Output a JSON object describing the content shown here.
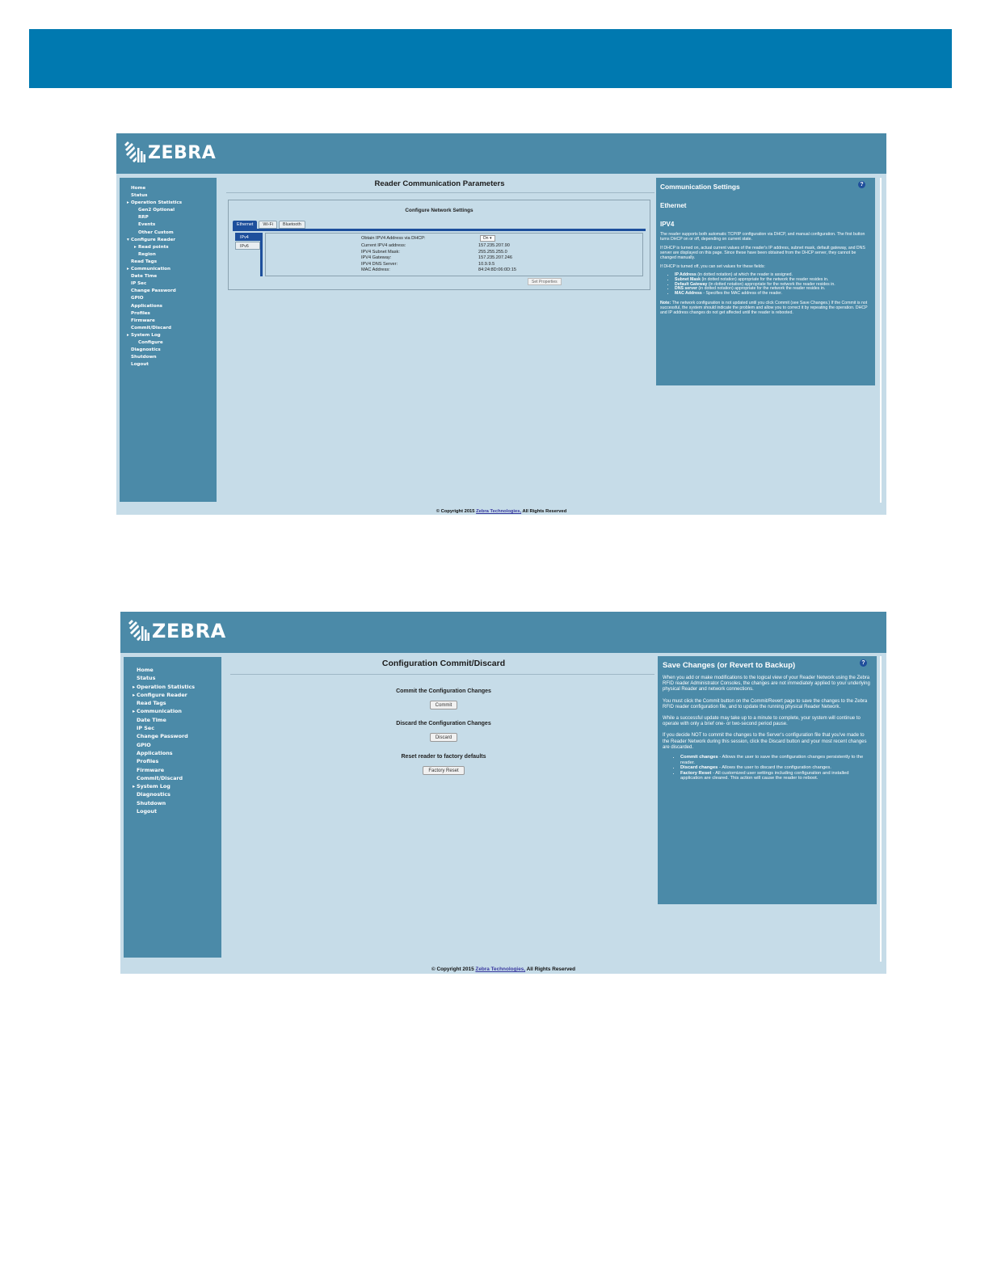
{
  "brand": {
    "logo_text": "ZEBRA"
  },
  "screen1": {
    "nav": [
      {
        "label": "Home",
        "arrow": "",
        "sub": false
      },
      {
        "label": "Status",
        "arrow": "",
        "sub": false
      },
      {
        "label": "Operation Statistics",
        "arrow": "▸",
        "sub": false
      },
      {
        "label": "Gen2 Optional",
        "arrow": "",
        "sub": true
      },
      {
        "label": "RRP",
        "arrow": "",
        "sub": true
      },
      {
        "label": "Events",
        "arrow": "",
        "sub": true
      },
      {
        "label": "Other Custom",
        "arrow": "",
        "sub": true
      },
      {
        "label": "Configure Reader",
        "arrow": "▾",
        "sub": false
      },
      {
        "label": "Read points",
        "arrow": "▸",
        "sub": true
      },
      {
        "label": "Region",
        "arrow": "",
        "sub": true
      },
      {
        "label": "Read Tags",
        "arrow": "",
        "sub": false
      },
      {
        "label": "Communication",
        "arrow": "▸",
        "sub": false
      },
      {
        "label": "Date Time",
        "arrow": "",
        "sub": false
      },
      {
        "label": "IP Sec",
        "arrow": "",
        "sub": false
      },
      {
        "label": "Change Password",
        "arrow": "",
        "sub": false
      },
      {
        "label": "GPIO",
        "arrow": "",
        "sub": false
      },
      {
        "label": "Applications",
        "arrow": "",
        "sub": false
      },
      {
        "label": "Profiles",
        "arrow": "",
        "sub": false
      },
      {
        "label": "Firmware",
        "arrow": "",
        "sub": false
      },
      {
        "label": "Commit/Discard",
        "arrow": "",
        "sub": false
      },
      {
        "label": "System Log",
        "arrow": "▸",
        "sub": false
      },
      {
        "label": "Configure",
        "arrow": "",
        "sub": true
      },
      {
        "label": "Diagnostics",
        "arrow": "",
        "sub": false
      },
      {
        "label": "Shutdown",
        "arrow": "",
        "sub": false
      },
      {
        "label": "Logout",
        "arrow": "",
        "sub": false
      }
    ],
    "title": "Reader Communication Parameters",
    "box_title": "Configure Network Settings",
    "tabs": [
      "Ethernet",
      "Wi-Fi",
      "Bluetooth"
    ],
    "subtabs": [
      "IPv4",
      "IPv6"
    ],
    "rows": [
      {
        "label": "Obtain IPV4 Address via DHCP:",
        "value": "On"
      },
      {
        "label": "Current IPV4 address:",
        "value": "157.235.207.90"
      },
      {
        "label": "IPV4 Subnet Mask:",
        "value": "255.255.255.0"
      },
      {
        "label": "IPV4 Gateway:",
        "value": "157.235.207.246"
      },
      {
        "label": "IPV4 DNS Server:",
        "value": "10.9.9.5"
      },
      {
        "label": "MAC Address:",
        "value": "84:24:8D:06:0D:15"
      }
    ],
    "set_properties": "Set Properties",
    "help": {
      "icon": "?",
      "title": "Communication Settings",
      "h2a": "Ethernet",
      "h2b": "IPV4",
      "p1": "The reader supports both automatic TCP/IP configuration via DHCP, and manual configuration. The first button turns DHCP on or off, depending on current state.",
      "p2": "If DHCP is turned on, actual current values of the reader's IP address, subnet mask, default gateway, and DNS server are displayed on this page. Since these have been obtained from the DHCP server, they cannot be changed manually.",
      "p3": "If DHCP is turned off, you can set values for these fields:",
      "list": [
        {
          "b": "IP Address",
          "t": " (in dotted notation) at which the reader is assigned."
        },
        {
          "b": "Subnet Mask",
          "t": " (in dotted notation) appropriate for the network the reader resides in."
        },
        {
          "b": "Default Gateway",
          "t": " (in dotted notation) appropriate for the network the reader resides in."
        },
        {
          "b": "DNS server",
          "t": " (in dotted notation) appropriate for the network the reader resides in."
        },
        {
          "b": "MAC Address",
          "t": " - Specifies the MAC address of the reader."
        }
      ],
      "note_b": "Note:",
      "note": " The network configuration is not updated until you click Commit (see Save Changes.) If the Commit is not successful, the system should indicate the problem and allow you to correct it by repeating the operation. DHCP and IP address changes do not get affected until the reader is rebooted."
    },
    "footer_pre": "© Copyright 2015 ",
    "footer_link": "Zebra Technologies,",
    "footer_post": " All Rights Reserved"
  },
  "screen2": {
    "nav": [
      {
        "label": "Home",
        "arrow": "",
        "sub": false
      },
      {
        "label": "Status",
        "arrow": "",
        "sub": false
      },
      {
        "label": "Operation Statistics",
        "arrow": "▸",
        "sub": false
      },
      {
        "label": "Configure Reader",
        "arrow": "▸",
        "sub": false
      },
      {
        "label": "Read Tags",
        "arrow": "",
        "sub": false
      },
      {
        "label": "Communication",
        "arrow": "▸",
        "sub": false
      },
      {
        "label": "Date Time",
        "arrow": "",
        "sub": false
      },
      {
        "label": "IP Sec",
        "arrow": "",
        "sub": false
      },
      {
        "label": "Change Password",
        "arrow": "",
        "sub": false
      },
      {
        "label": "GPIO",
        "arrow": "",
        "sub": false
      },
      {
        "label": "Applications",
        "arrow": "",
        "sub": false
      },
      {
        "label": "Profiles",
        "arrow": "",
        "sub": false
      },
      {
        "label": "Firmware",
        "arrow": "",
        "sub": false
      },
      {
        "label": "Commit/Discard",
        "arrow": "",
        "sub": false
      },
      {
        "label": "System Log",
        "arrow": "▸",
        "sub": false
      },
      {
        "label": "Diagnostics",
        "arrow": "",
        "sub": false
      },
      {
        "label": "Shutdown",
        "arrow": "",
        "sub": false
      },
      {
        "label": "Logout",
        "arrow": "",
        "sub": false
      }
    ],
    "title": "Configuration Commit/Discard",
    "commit_label": "Commit the Configuration Changes",
    "commit_button": "Commit",
    "discard_label": "Discard the Configuration Changes",
    "discard_button": "Discard",
    "reset_label": "Reset reader to factory defaults",
    "reset_button": "Factory Reset",
    "help": {
      "icon": "?",
      "title": "Save Changes (or Revert to Backup)",
      "p1": "When you add or make modifications to the logical view of your Reader Network using the Zebra RFID reader Administrator Consoles, the changes are not immediately applied to your underlying physical Reader and network connections.",
      "p2": "You must click the Commit button on the Commit/Revert page to save the changes to the Zebra RFID reader configuration file, and to update the running physical Reader Network.",
      "p3": "While a successful update may take up to a minute to complete, your system will continue to operate with only a brief one- or two-second period pause.",
      "p4": "If you decide NOT to commit the changes to the Server's configuration file that you've made to the Reader Network during this session, click the Discard button and your most recent changes are discarded.",
      "list": [
        {
          "b": "Commit changes",
          "t": " - Allows the user to save the configuration changes persistently to the reader."
        },
        {
          "b": "Discard changes",
          "t": " - Allows the user to discard the configuration changes."
        },
        {
          "b": "Factory Reset",
          "t": " - All customized user settings including configuration and installed application are cleared. This action will cause the reader to reboot."
        }
      ]
    },
    "footer_pre": "© Copyright 2015 ",
    "footer_link": "Zebra Technologies,",
    "footer_post": " All Rights Reserved"
  }
}
